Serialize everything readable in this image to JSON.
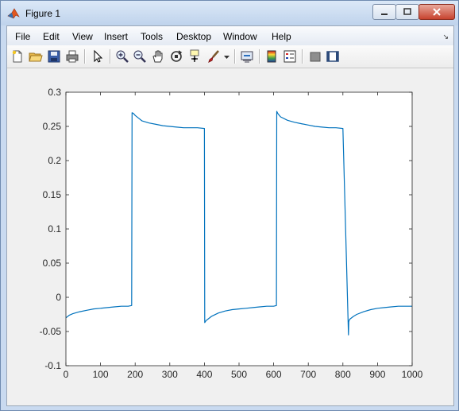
{
  "window": {
    "title": "Figure 1"
  },
  "menu": [
    "File",
    "Edit",
    "View",
    "Insert",
    "Tools",
    "Desktop",
    "Window",
    "Help"
  ],
  "toolbar_icons": [
    "new-figure-icon",
    "open-file-icon",
    "save-icon",
    "print-icon",
    "select-arrow-icon",
    "zoom-in-icon",
    "zoom-out-icon",
    "pan-hand-icon",
    "rotate-3d-icon",
    "data-cursor-icon",
    "brush-icon",
    "brush-dropdown-icon",
    "link-plot-icon",
    "insert-colorbar-icon",
    "insert-legend-icon",
    "hide-plot-tools-icon",
    "show-plot-tools-icon"
  ],
  "colors": {
    "line": "#0072bd",
    "axes_bg": "#ffffff",
    "figure_bg": "#f0f0f0"
  },
  "chart_data": {
    "type": "line",
    "xlim": [
      0,
      1000
    ],
    "ylim": [
      -0.1,
      0.3
    ],
    "xticks": [
      "0",
      "100",
      "200",
      "300",
      "400",
      "500",
      "600",
      "700",
      "800",
      "900",
      "1000"
    ],
    "yticks": [
      "-0.1",
      "-0.05",
      "0",
      "0.05",
      "0.1",
      "0.15",
      "0.2",
      "0.25",
      "0.3"
    ],
    "x": [
      0,
      10,
      20,
      40,
      60,
      80,
      100,
      120,
      140,
      160,
      180,
      190,
      191,
      195,
      200,
      210,
      220,
      240,
      260,
      280,
      300,
      320,
      340,
      360,
      380,
      400,
      401,
      405,
      410,
      420,
      440,
      460,
      480,
      500,
      520,
      540,
      560,
      580,
      600,
      608,
      609,
      612,
      620,
      640,
      660,
      680,
      700,
      720,
      740,
      760,
      780,
      800,
      816,
      817,
      818,
      820,
      830,
      840,
      860,
      880,
      900,
      920,
      940,
      960,
      980,
      1000
    ],
    "y": [
      -0.03,
      -0.026,
      -0.024,
      -0.021,
      -0.019,
      -0.017,
      -0.016,
      -0.015,
      -0.014,
      -0.013,
      -0.013,
      -0.012,
      0.27,
      0.269,
      0.266,
      0.262,
      0.258,
      0.255,
      0.253,
      0.251,
      0.25,
      0.249,
      0.248,
      0.248,
      0.248,
      0.247,
      -0.037,
      -0.034,
      -0.032,
      -0.028,
      -0.023,
      -0.02,
      -0.018,
      -0.017,
      -0.016,
      -0.015,
      -0.014,
      -0.013,
      -0.013,
      -0.012,
      0.272,
      0.269,
      0.264,
      0.259,
      0.256,
      0.254,
      0.252,
      0.25,
      0.249,
      0.248,
      0.248,
      0.247,
      -0.055,
      -0.036,
      -0.034,
      -0.032,
      -0.028,
      -0.025,
      -0.021,
      -0.018,
      -0.016,
      -0.015,
      -0.014,
      -0.013,
      -0.013,
      -0.013
    ]
  }
}
